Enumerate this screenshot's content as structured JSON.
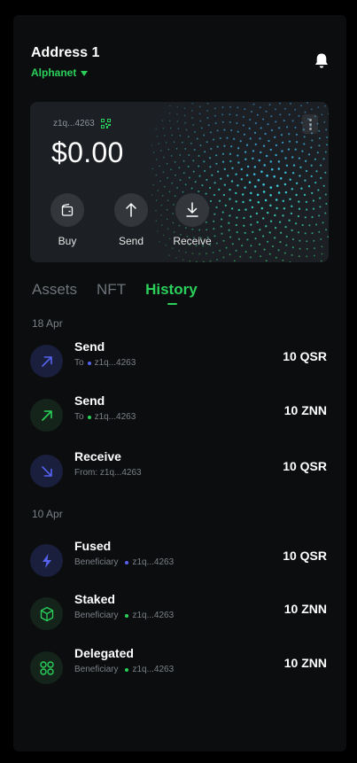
{
  "header": {
    "address_name": "Address 1",
    "network": "Alphanet"
  },
  "card": {
    "address_short": "z1q...4263",
    "balance": "$0.00",
    "actions": [
      {
        "label": "Buy",
        "icon": "wallet-icon"
      },
      {
        "label": "Send",
        "icon": "arrow-up-icon"
      },
      {
        "label": "Receive",
        "icon": "arrow-down-icon"
      }
    ]
  },
  "tabs": [
    {
      "label": "Assets",
      "active": false
    },
    {
      "label": "NFT",
      "active": false
    },
    {
      "label": "History",
      "active": true
    }
  ],
  "history": {
    "groups": [
      {
        "date": "18 Apr",
        "items": [
          {
            "title": "Send",
            "prefix": "To",
            "address": "z1q...4263",
            "amount": "10 QSR",
            "icon": "arrow-up-right-icon",
            "color": "blue"
          },
          {
            "title": "Send",
            "prefix": "To",
            "address": "z1q...4263",
            "amount": "10 ZNN",
            "icon": "arrow-up-right-icon",
            "color": "green"
          },
          {
            "title": "Receive",
            "prefix": "From: z1q...4263",
            "address": "",
            "amount": "10 QSR",
            "icon": "arrow-down-right-icon",
            "color": "blue"
          }
        ]
      },
      {
        "date": "10 Apr",
        "items": [
          {
            "title": "Fused",
            "prefix": "Beneficiary",
            "address": "z1q...4263",
            "amount": "10 QSR",
            "icon": "lightning-icon",
            "color": "blue"
          },
          {
            "title": "Staked",
            "prefix": "Beneficiary",
            "address": "z1q...4263",
            "amount": "10 ZNN",
            "icon": "cube-icon",
            "color": "green"
          },
          {
            "title": "Delegated",
            "prefix": "Beneficiary",
            "address": "z1q...4263",
            "amount": "10 ZNN",
            "icon": "nodes-icon",
            "color": "green"
          }
        ]
      }
    ]
  },
  "colors": {
    "accent_green": "#2ad05a",
    "accent_blue": "#5563f0",
    "background": "#0b0d0f",
    "card": "#1c1f23"
  }
}
